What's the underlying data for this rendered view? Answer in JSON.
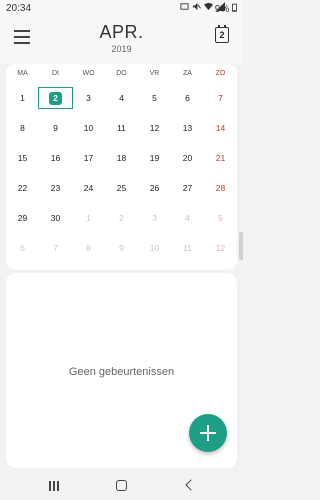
{
  "status": {
    "time": "20:34",
    "battery_text": "9%",
    "icons": [
      "cast-icon",
      "mute-icon",
      "wifi-icon",
      "signal-icon",
      "battery-icon"
    ]
  },
  "header": {
    "month": "APR.",
    "year": "2019",
    "today_day": "2",
    "menu_icon": "hamburger-menu-icon",
    "today_icon": "calendar-today-icon"
  },
  "calendar": {
    "weekdays": [
      "MA",
      "DI",
      "WO",
      "DO",
      "VR",
      "ZA",
      "ZO"
    ],
    "weeks": [
      [
        "1",
        "2",
        "3",
        "4",
        "5",
        "6",
        "7"
      ],
      [
        "8",
        "9",
        "10",
        "11",
        "12",
        "13",
        "14"
      ],
      [
        "15",
        "16",
        "17",
        "18",
        "19",
        "20",
        "21"
      ],
      [
        "22",
        "23",
        "24",
        "25",
        "26",
        "27",
        "28"
      ],
      [
        "29",
        "30",
        "1",
        "2",
        "3",
        "4",
        "5"
      ],
      [
        "6",
        "7",
        "8",
        "9",
        "10",
        "11",
        "12"
      ]
    ],
    "today_week": 0,
    "today_index": 1
  },
  "events": {
    "empty_text": "Geen gebeurtenissen"
  },
  "fab": {
    "icon": "plus-icon"
  },
  "nav": {
    "recent_icon": "recent-apps-icon",
    "home_icon": "home-icon",
    "back_icon": "back-icon"
  },
  "colors": {
    "accent": "#1e9e86",
    "sunday": "#c0392b"
  }
}
